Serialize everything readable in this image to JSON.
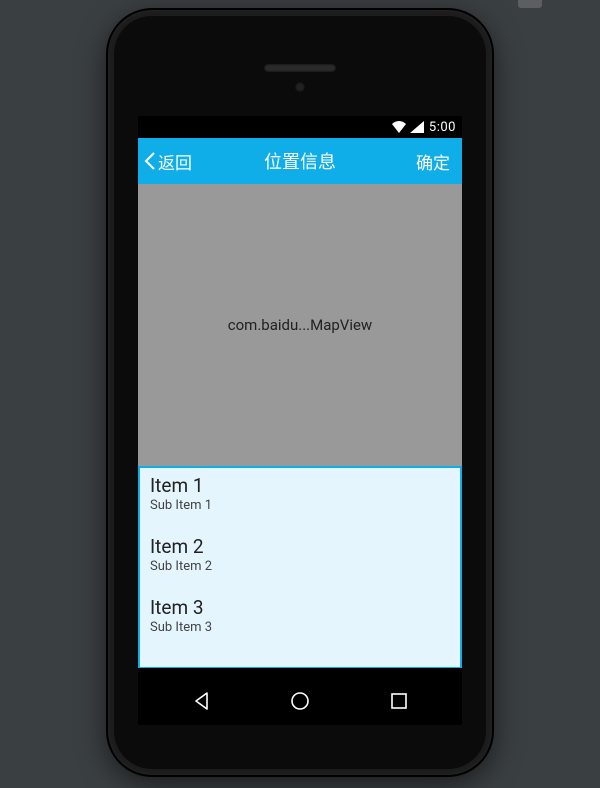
{
  "status": {
    "time": "5:00"
  },
  "appbar": {
    "back_label": "返回",
    "title": "位置信息",
    "confirm_label": "确定"
  },
  "map": {
    "placeholder": "com.baidu...MapView"
  },
  "list": {
    "items": [
      {
        "title": "Item 1",
        "subtitle": "Sub Item 1"
      },
      {
        "title": "Item 2",
        "subtitle": "Sub Item 2"
      },
      {
        "title": "Item 3",
        "subtitle": "Sub Item 3"
      }
    ]
  },
  "colors": {
    "accent": "#10aee8",
    "list_bg": "#e4f5fd",
    "map_bg": "#999999",
    "page_bg": "#3a3f41"
  }
}
